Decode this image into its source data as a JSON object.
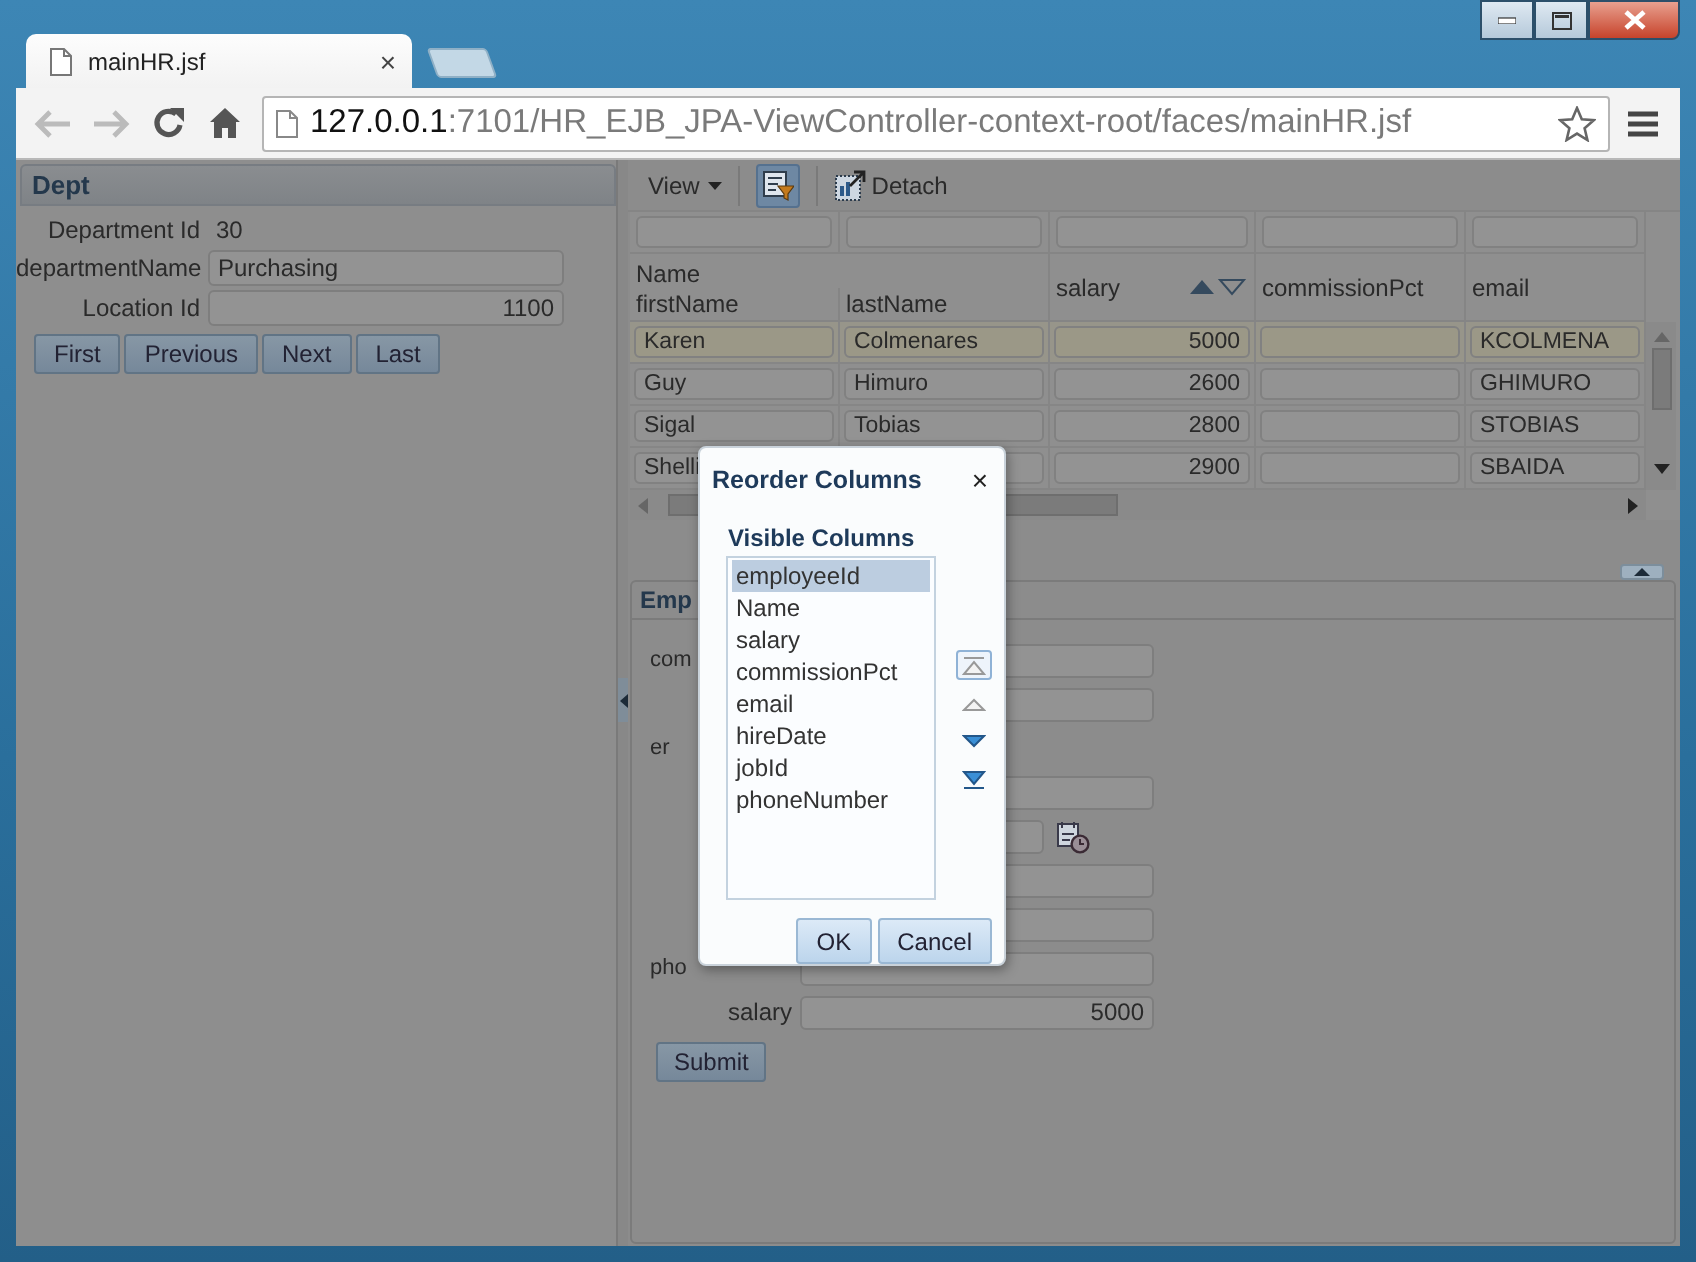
{
  "browser": {
    "tab_title": "mainHR.jsf",
    "tab_close": "×",
    "url_host": "127.0.0.1",
    "url_path": ":7101/HR_EJB_JPA-ViewController-context-root/faces/mainHR.jsf"
  },
  "dept": {
    "title": "Dept",
    "fields": [
      {
        "label": "Department Id",
        "value": "30",
        "kind": "text"
      },
      {
        "label": "departmentName",
        "value": "Purchasing",
        "kind": "input"
      },
      {
        "label": "Location Id",
        "value": "1100",
        "kind": "number"
      }
    ],
    "buttons": [
      "First",
      "Previous",
      "Next",
      "Last"
    ]
  },
  "table_toolbar": {
    "view_menu": "View",
    "filter_on": true,
    "detach": "Detach"
  },
  "table": {
    "group_header": "Name",
    "columns": [
      {
        "label": "firstName",
        "kind": "text"
      },
      {
        "label": "lastName",
        "kind": "text"
      },
      {
        "label": "salary",
        "kind": "number",
        "sortable": true
      },
      {
        "label": "commissionPct",
        "kind": "number"
      },
      {
        "label": "email",
        "kind": "text"
      }
    ],
    "rows": [
      {
        "selected": true,
        "first_name": "Karen",
        "last_name": "Colmenares",
        "salary": "5000",
        "email": "KCOLMENA"
      },
      {
        "selected": false,
        "first_name": "Guy",
        "last_name": "Himuro",
        "salary": "2600",
        "email": "GHIMURO"
      },
      {
        "selected": false,
        "first_name": "Sigal",
        "last_name": "Tobias",
        "salary": "2800",
        "email": "STOBIAS"
      },
      {
        "selected": false,
        "first_name": "Shelli",
        "salary": "2900",
        "email": "SBAIDA"
      }
    ]
  },
  "employee": {
    "title": "Emp",
    "fields": [
      {
        "label": "com",
        "kind": "input"
      },
      {
        "kind": "input"
      },
      {
        "label": "er",
        "kind": "label_only"
      },
      {
        "kind": "input"
      },
      {
        "kind": "date"
      },
      {
        "kind": "input"
      },
      {
        "kind": "input"
      },
      {
        "label": "pho",
        "kind": "input"
      },
      {
        "label": "salary",
        "kind": "input",
        "value": "5000"
      }
    ],
    "submit": "Submit"
  },
  "dialog": {
    "title": "Reorder Columns",
    "close": "×",
    "list_label": "Visible Columns",
    "items": [
      {
        "label": "employeeId",
        "selected": true
      },
      {
        "label": "Name",
        "selected": false
      },
      {
        "label": "salary",
        "selected": false
      },
      {
        "label": "commissionPct",
        "selected": false
      },
      {
        "label": "email",
        "selected": false
      },
      {
        "label": "hireDate",
        "selected": false
      },
      {
        "label": "jobId",
        "selected": false
      },
      {
        "label": "phoneNumber",
        "selected": false
      }
    ],
    "move_buttons": [
      {
        "kind": "top",
        "disabled": true,
        "focused": true
      },
      {
        "kind": "up",
        "disabled": true,
        "focused": false
      },
      {
        "kind": "down",
        "disabled": false,
        "focused": false
      },
      {
        "kind": "bottom",
        "disabled": false,
        "focused": false
      }
    ],
    "buttons": [
      "OK",
      "Cancel"
    ]
  }
}
